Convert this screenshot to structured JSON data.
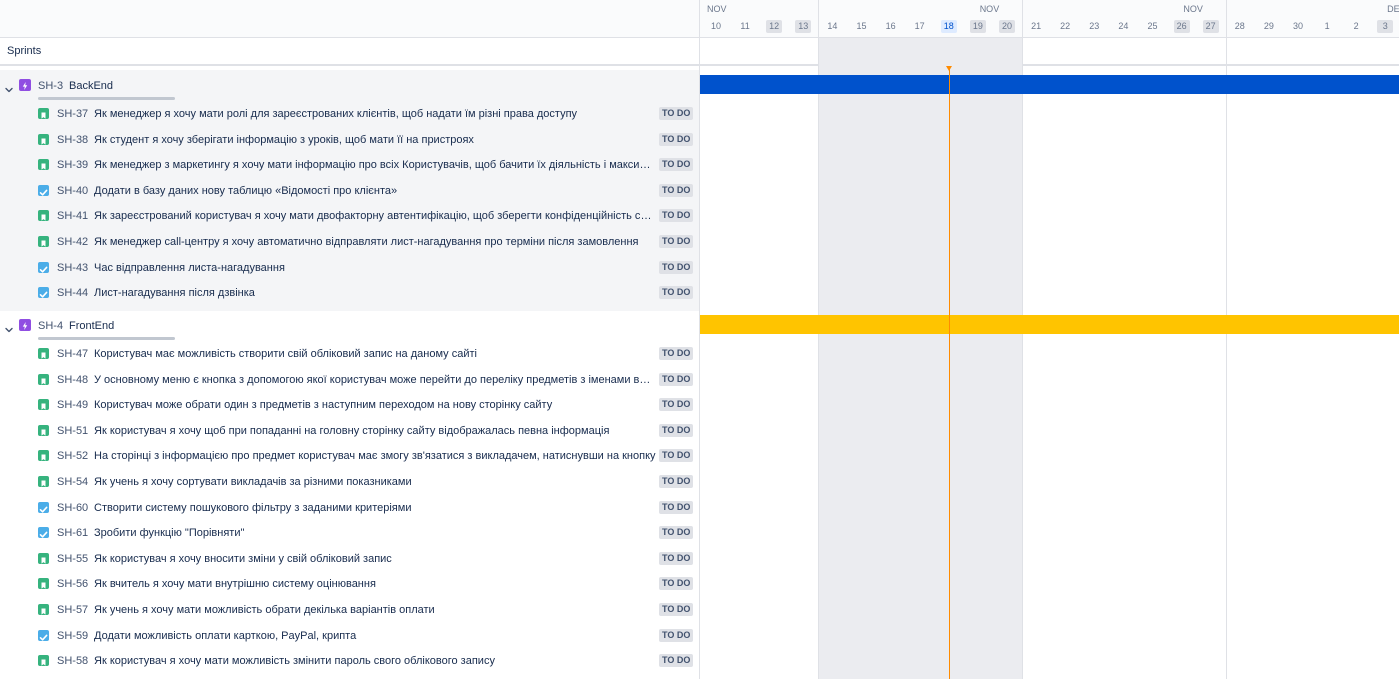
{
  "sprints_label": "Sprints",
  "badge_label": "TO DO",
  "colors": {
    "epic_backend_bar": "#0052cc",
    "epic_frontend_bar": "#ffc400",
    "today_line": "#ff8b00",
    "story_icon": "#36b37e",
    "task_icon": "#4bade8",
    "epic_icon": "#904ee2"
  },
  "timeline": {
    "months": [
      "NOV",
      "NOV",
      "NOV",
      "DEC"
    ],
    "days": [
      "10",
      "11",
      "12",
      "13",
      "14",
      "15",
      "16",
      "17",
      "18",
      "19",
      "20",
      "21",
      "22",
      "23",
      "24",
      "25",
      "26",
      "27",
      "28",
      "29",
      "30",
      "1",
      "2",
      "3"
    ],
    "weekend_days": [
      "12",
      "13",
      "19",
      "20",
      "26",
      "27",
      "3"
    ],
    "today": "18"
  },
  "epics": [
    {
      "key": "SH-3",
      "name": "BackEnd",
      "icon": "epic-icon",
      "stories": [
        {
          "key": "SH-37",
          "type": "story",
          "icon": "bookmark-icon",
          "summary": "Як менеджер я хочу мати ролі для зареєстрованих клієнтів, щоб надати їм різні права доступу",
          "status": "TO DO"
        },
        {
          "key": "SH-38",
          "type": "story",
          "icon": "bookmark-icon",
          "summary": "Як студент я хочу зберігати інформацію з уроків, щоб мати її на пристроях",
          "status": "TO DO"
        },
        {
          "key": "SH-39",
          "type": "story",
          "icon": "bookmark-icon",
          "summary": "Як менеджер з маркетингу я хочу мати інформацію про всіх Користувачів, щоб бачити їх діяльність і максимально",
          "status": "TO DO"
        },
        {
          "key": "SH-40",
          "type": "task",
          "icon": "checkbox-icon",
          "summary": "Додати в базу даних нову таблицю «Відомості про клієнта»",
          "status": "TO DO"
        },
        {
          "key": "SH-41",
          "type": "story",
          "icon": "bookmark-icon",
          "summary": "Як зареєстрований користувач я хочу мати двофакторну автентифікацію, щоб зберегти конфіденційність своїх даних",
          "status": "TO DO"
        },
        {
          "key": "SH-42",
          "type": "story",
          "icon": "bookmark-icon",
          "summary": "Як менеджер call-центру я хочу автоматично відправляти лист-нагадування про терміни після замовлення",
          "status": "TO DO"
        },
        {
          "key": "SH-43",
          "type": "task",
          "icon": "checkbox-icon",
          "summary": "Час відправлення листа-нагадування",
          "status": "TO DO"
        },
        {
          "key": "SH-44",
          "type": "task",
          "icon": "checkbox-icon",
          "summary": "Лист-нагадування після дзвінка",
          "status": "TO DO"
        }
      ]
    },
    {
      "key": "SH-4",
      "name": "FrontEnd",
      "icon": "epic-icon",
      "stories": [
        {
          "key": "SH-47",
          "type": "story",
          "icon": "bookmark-icon",
          "summary": "Користувач має можливість створити свій обліковий запис на даному сайті",
          "status": "TO DO"
        },
        {
          "key": "SH-48",
          "type": "story",
          "icon": "bookmark-icon",
          "summary": "У основному меню є кнопка з допомогою якої користувач може перейти до переліку предметів з іменами викладачів",
          "status": "TO DO"
        },
        {
          "key": "SH-49",
          "type": "story",
          "icon": "bookmark-icon",
          "summary": "Користувач може обрати один з предметів з наступним переходом на нову сторінку сайту",
          "status": "TO DO"
        },
        {
          "key": "SH-51",
          "type": "story",
          "icon": "bookmark-icon",
          "summary": "Як користувач я хочу щоб при попаданні на головну сторінку сайту відображалась певна інформація",
          "status": "TO DO"
        },
        {
          "key": "SH-52",
          "type": "story",
          "icon": "bookmark-icon",
          "summary": "На сторінці з інформацією про предмет користувач має змогу зв'язатися з викладачем, натиснувши на кнопку",
          "status": "TO DO"
        },
        {
          "key": "SH-54",
          "type": "story",
          "icon": "bookmark-icon",
          "summary": "Як учень я хочу сортувати викладачів за різними показниками",
          "status": "TO DO"
        },
        {
          "key": "SH-60",
          "type": "task",
          "icon": "checkbox-icon",
          "summary": "Створити систему пошукового фільтру з заданими критеріями",
          "status": "TO DO"
        },
        {
          "key": "SH-61",
          "type": "task",
          "icon": "checkbox-icon",
          "summary": "Зробити функцію \"Порівняти\"",
          "status": "TO DO"
        },
        {
          "key": "SH-55",
          "type": "story",
          "icon": "bookmark-icon",
          "summary": "Як користувач я хочу вносити зміни у свій обліковий запис",
          "status": "TO DO"
        },
        {
          "key": "SH-56",
          "type": "story",
          "icon": "bookmark-icon",
          "summary": "Як вчитель я хочу мати внутрішню систему оцінювання",
          "status": "TO DO"
        },
        {
          "key": "SH-57",
          "type": "story",
          "icon": "bookmark-icon",
          "summary": "Як учень я хочу мати можливість обрати декілька варіантів оплати",
          "status": "TO DO"
        },
        {
          "key": "SH-59",
          "type": "task",
          "icon": "checkbox-icon",
          "summary": "Додати можливість оплати карткою, PayPal, крипта",
          "status": "TO DO"
        },
        {
          "key": "SH-58",
          "type": "story",
          "icon": "bookmark-icon",
          "summary": "Як користувач я хочу мати можливість змінити пароль свого облікового запису",
          "status": "TO DO"
        }
      ]
    }
  ]
}
